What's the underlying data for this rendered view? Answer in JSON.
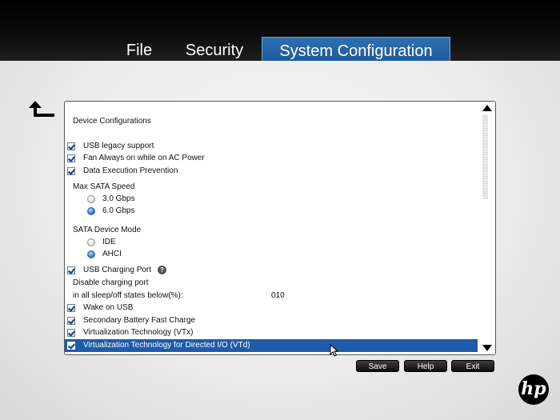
{
  "tabs": [
    {
      "label": "File"
    },
    {
      "label": "Security"
    },
    {
      "label": "System Configuration",
      "active": true
    }
  ],
  "panel": {
    "section_title": "Device Configurations",
    "usb_legacy": {
      "label": "USB legacy support",
      "checked": true
    },
    "fan_always_on": {
      "label": "Fan Always on while on AC Power",
      "checked": true
    },
    "dep": {
      "label": "Data Execution Prevention",
      "checked": true
    },
    "sata_speed": {
      "label": "Max SATA Speed",
      "options": [
        "3.0 Gbps",
        "6.0 Gbps"
      ],
      "selected": "6.0 Gbps"
    },
    "sata_mode": {
      "label": "SATA Device Mode",
      "options": [
        "IDE",
        "AHCI"
      ],
      "selected": "AHCI"
    },
    "usb_charging": {
      "label": "USB Charging Port",
      "checked": true,
      "help_glyph": "?"
    },
    "disable_charging": {
      "line1": "Disable charging port",
      "line2": "in all sleep/off states below(%):",
      "value": "010"
    },
    "wake_usb": {
      "label": "Wake on USB",
      "checked": true
    },
    "fast_charge": {
      "label": "Secondary Battery Fast Charge",
      "checked": true
    },
    "vtx": {
      "label": "Virtualization Technology (VTx)",
      "checked": true
    },
    "vtd": {
      "label": "Virtualization Technology for Directed I/O (VTd)",
      "checked": true,
      "selected": true
    }
  },
  "buttons": {
    "save": "Save",
    "help": "Help",
    "exit": "Exit"
  },
  "logo": {
    "text": "hp"
  },
  "colors": {
    "accent": "#1f5ba8",
    "tab_active": "#2f6fb1",
    "topbar": "#000000"
  }
}
